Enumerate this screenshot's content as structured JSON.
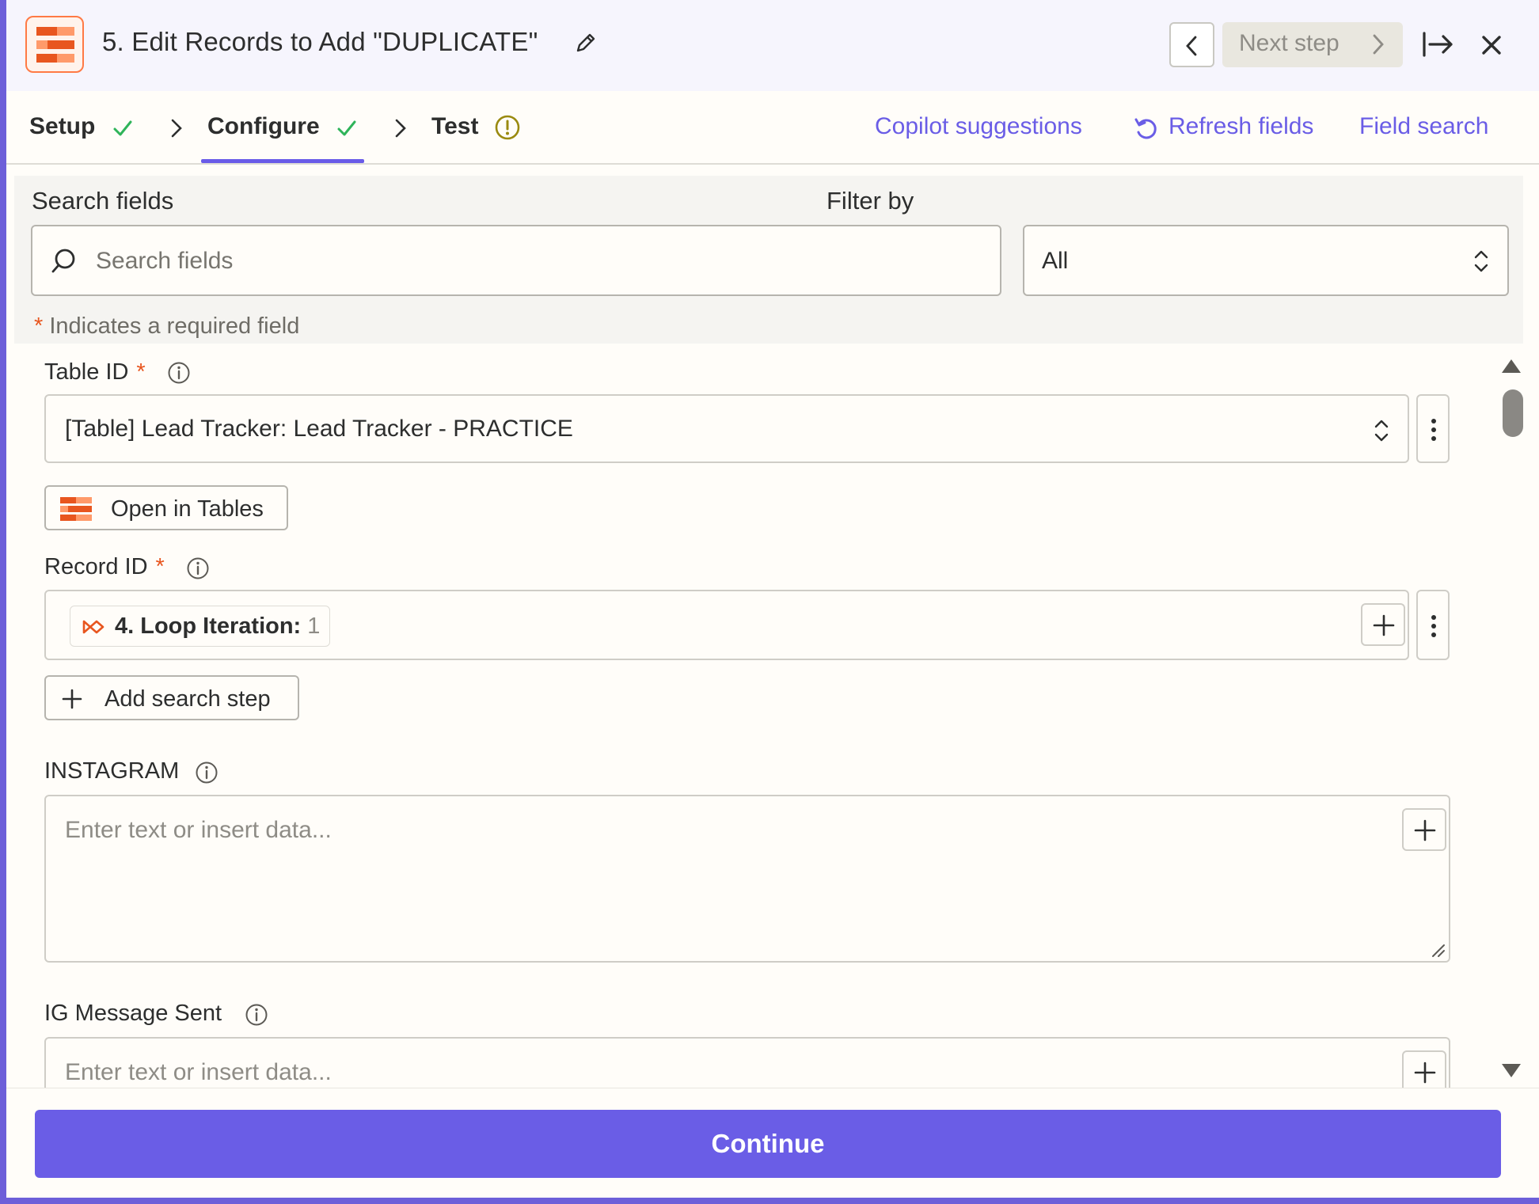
{
  "header": {
    "title": "5. Edit Records to Add \"DUPLICATE\"",
    "next_step_label": "Next step"
  },
  "tabs": [
    {
      "label": "Setup",
      "status": "complete"
    },
    {
      "label": "Configure",
      "status": "complete"
    },
    {
      "label": "Test",
      "status": "warning"
    }
  ],
  "links": {
    "copilot": "Copilot suggestions",
    "refresh": "Refresh fields",
    "field_search": "Field search"
  },
  "search_panel": {
    "search_label": "Search fields",
    "search_placeholder": "Search fields",
    "filter_label": "Filter by",
    "filter_value": "All",
    "required_star": "*",
    "required_note": "Indicates a required field"
  },
  "fields": {
    "table_id": {
      "label": "Table ID",
      "required": "*",
      "value": "[Table] Lead Tracker: Lead Tracker - PRACTICE",
      "open_button": "Open in Tables"
    },
    "record_id": {
      "label": "Record ID",
      "required": "*",
      "pill_step": "4. Loop Iteration:",
      "pill_value": "1",
      "add_search_button": "Add search step"
    },
    "instagram": {
      "label": "INSTAGRAM",
      "placeholder": "Enter text or insert data..."
    },
    "ig_message_sent": {
      "label": "IG Message Sent",
      "placeholder": "Enter text or insert data..."
    }
  },
  "footer": {
    "continue_label": "Continue"
  },
  "colors": {
    "accent": "#6a5de6",
    "brand_orange": "#e8561f",
    "success_green": "#2fb45a",
    "warning_olive": "#9a8a10"
  }
}
